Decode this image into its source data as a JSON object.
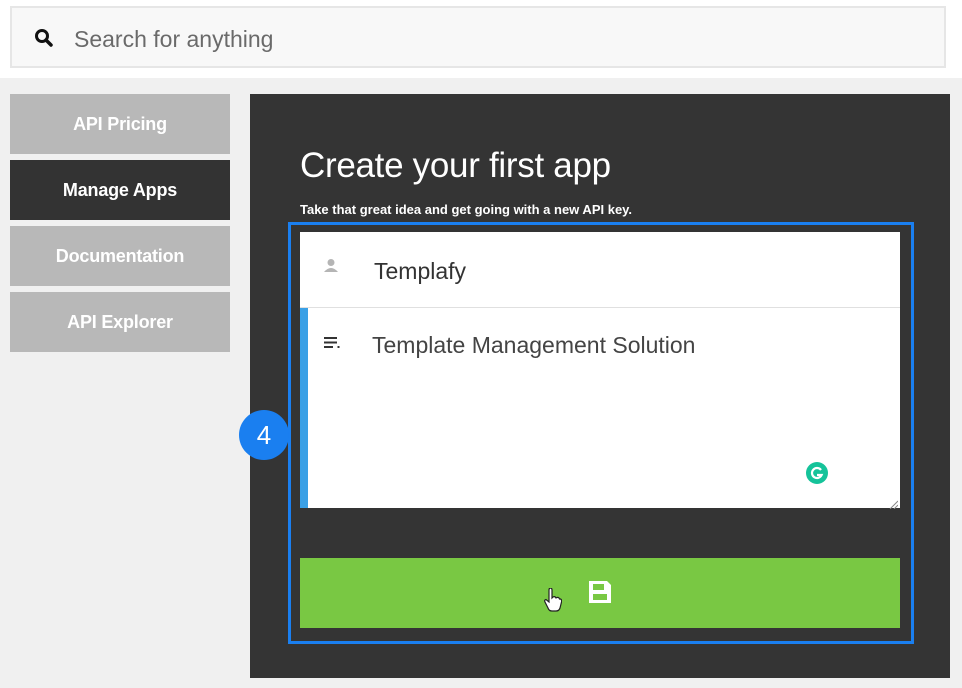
{
  "search": {
    "placeholder": "Search for anything",
    "value": ""
  },
  "sidebar": {
    "items": [
      {
        "label": "API Pricing",
        "active": false
      },
      {
        "label": "Manage Apps",
        "active": true
      },
      {
        "label": "Documentation",
        "active": false
      },
      {
        "label": "API Explorer",
        "active": false
      }
    ]
  },
  "form": {
    "title": "Create your first app",
    "subtitle": "Take that great idea and get going with a new API key.",
    "name_value": "Templafy",
    "description_value": "Template Management Solution",
    "save_icon": "floppy-disk-icon"
  },
  "annotation": {
    "step": "4"
  },
  "colors": {
    "panel_bg": "#343434",
    "save_button": "#79c843",
    "highlight": "#1a7ff0",
    "active_nav": "#333333",
    "inactive_nav": "#b8b8b8",
    "grammarly": "#15c39a"
  }
}
